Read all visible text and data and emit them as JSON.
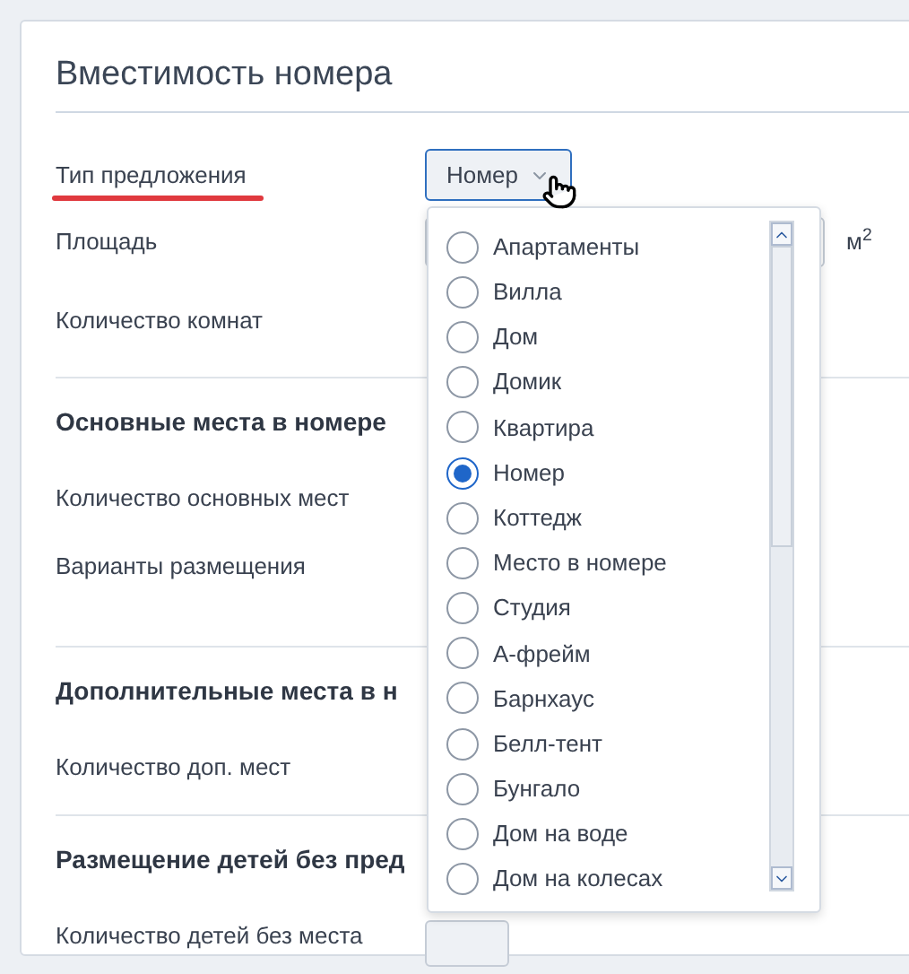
{
  "card": {
    "title": "Вместимость номера"
  },
  "offer_type": {
    "label": "Тип предложения",
    "highlighted": true,
    "value": "Номер",
    "expanded": true
  },
  "area": {
    "label": "Площадь",
    "unit": "м$^{2}$"
  },
  "rooms": {
    "label": "Количество комнат"
  },
  "sections": [
    {
      "title": "Основные места в номере",
      "fields": [
        "Количество основных мест",
        "Варианты размещения"
      ]
    },
    {
      "title": "Дополнительные места в н",
      "fields": [
        "Количество доп. мест"
      ]
    },
    {
      "title": "Размещение детей без пред",
      "fields": [
        "Количество детей без места"
      ]
    }
  ],
  "options": [
    {
      "label": "Апартаменты",
      "selected": false
    },
    {
      "label": "Вилла",
      "selected": false
    },
    {
      "label": "Дом",
      "selected": false
    },
    {
      "label": "Домик",
      "selected": false
    },
    {
      "label": "Квартира",
      "selected": false
    },
    {
      "label": "Номер",
      "selected": true
    },
    {
      "label": "Коттедж",
      "selected": false
    },
    {
      "label": "Место в номере",
      "selected": false
    },
    {
      "label": "Студия",
      "selected": false
    },
    {
      "label": "А-фрейм",
      "selected": false
    },
    {
      "label": "Барнхаус",
      "selected": false
    },
    {
      "label": "Белл-тент",
      "selected": false
    },
    {
      "label": "Бунгало",
      "selected": false
    },
    {
      "label": "Дом на воде",
      "selected": false
    },
    {
      "label": "Дом на колесах",
      "selected": false
    }
  ]
}
